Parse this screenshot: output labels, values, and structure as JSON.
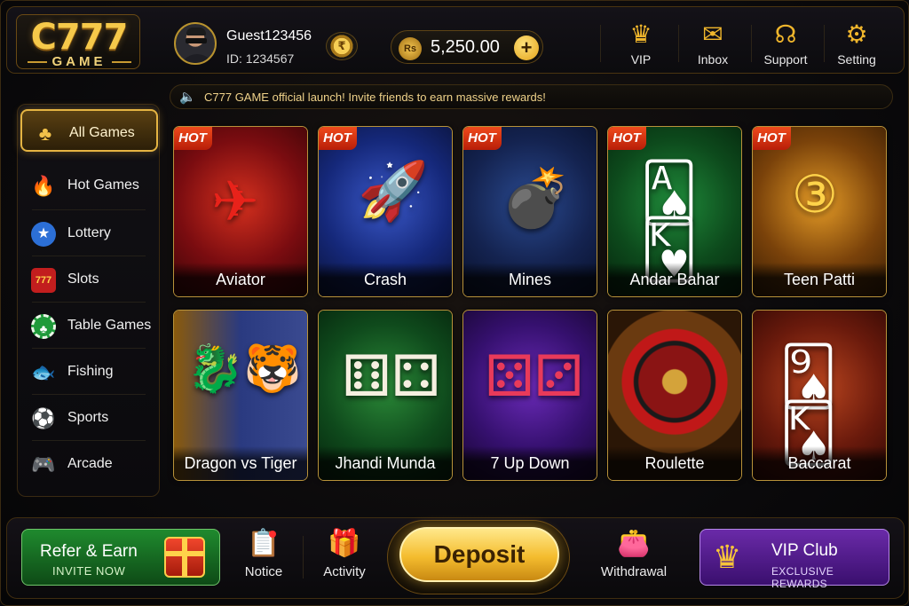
{
  "brand": {
    "logo_main": "C777",
    "logo_sub": "GAME"
  },
  "user": {
    "name": "Guest123456",
    "id": "ID: 1234567"
  },
  "wallet": {
    "currency": "Rs",
    "balance": "5,250.00",
    "add": "+",
    "coin_glyph": "₹"
  },
  "header_nav": [
    {
      "label": "VIP",
      "icon": "crown-icon"
    },
    {
      "label": "Inbox",
      "icon": "mail-icon"
    },
    {
      "label": "Support",
      "icon": "headset-icon"
    },
    {
      "label": "Setting",
      "icon": "gear-icon"
    }
  ],
  "marquee": {
    "text": "C777 GAME official launch! Invite friends to earn massive rewards!",
    "icon": "speaker-icon"
  },
  "sidebar": {
    "items": [
      {
        "label": "All Games",
        "icon": "club-icon",
        "active": true
      },
      {
        "label": "Hot Games",
        "icon": "fire-icon"
      },
      {
        "label": "Lottery",
        "icon": "lottery-icon"
      },
      {
        "label": "Slots",
        "icon": "slot-777-icon"
      },
      {
        "label": "Table Games",
        "icon": "chip-icon"
      },
      {
        "label": "Fishing",
        "icon": "fish-icon"
      },
      {
        "label": "Sports",
        "icon": "soccer-ball-icon"
      },
      {
        "label": "Arcade",
        "icon": "gamepad-icon"
      }
    ]
  },
  "games": [
    {
      "name": "Aviator",
      "hot": "HOT",
      "color": "#8b0f12"
    },
    {
      "name": "Crash",
      "hot": "HOT",
      "color": "#1d2f7a"
    },
    {
      "name": "Mines",
      "hot": "HOT",
      "color": "#1a2a55"
    },
    {
      "name": "Andar Bahar",
      "hot": "HOT",
      "color": "#0f4d22"
    },
    {
      "name": "Teen Patti",
      "hot": "HOT",
      "color": "#6b3a08"
    },
    {
      "name": "Dragon vs Tiger",
      "color": "#1d3a7a"
    },
    {
      "name": "Jhandi Munda",
      "color": "#114a1e"
    },
    {
      "name": "7 Up Down",
      "color": "#3a1570"
    },
    {
      "name": "Roulette",
      "color": "#3b1f0b"
    },
    {
      "name": "Baccarat",
      "color": "#6b1a0c"
    }
  ],
  "bottom": {
    "refer": {
      "title": "Refer & Earn",
      "subtitle": "INVITE NOW"
    },
    "notice": "Notice",
    "activity": "Activity",
    "deposit": "Deposit",
    "withdrawal": "Withdrawal",
    "vip_club": {
      "title": "VIP Club",
      "subtitle": "EXCLUSIVE REWARDS"
    }
  }
}
